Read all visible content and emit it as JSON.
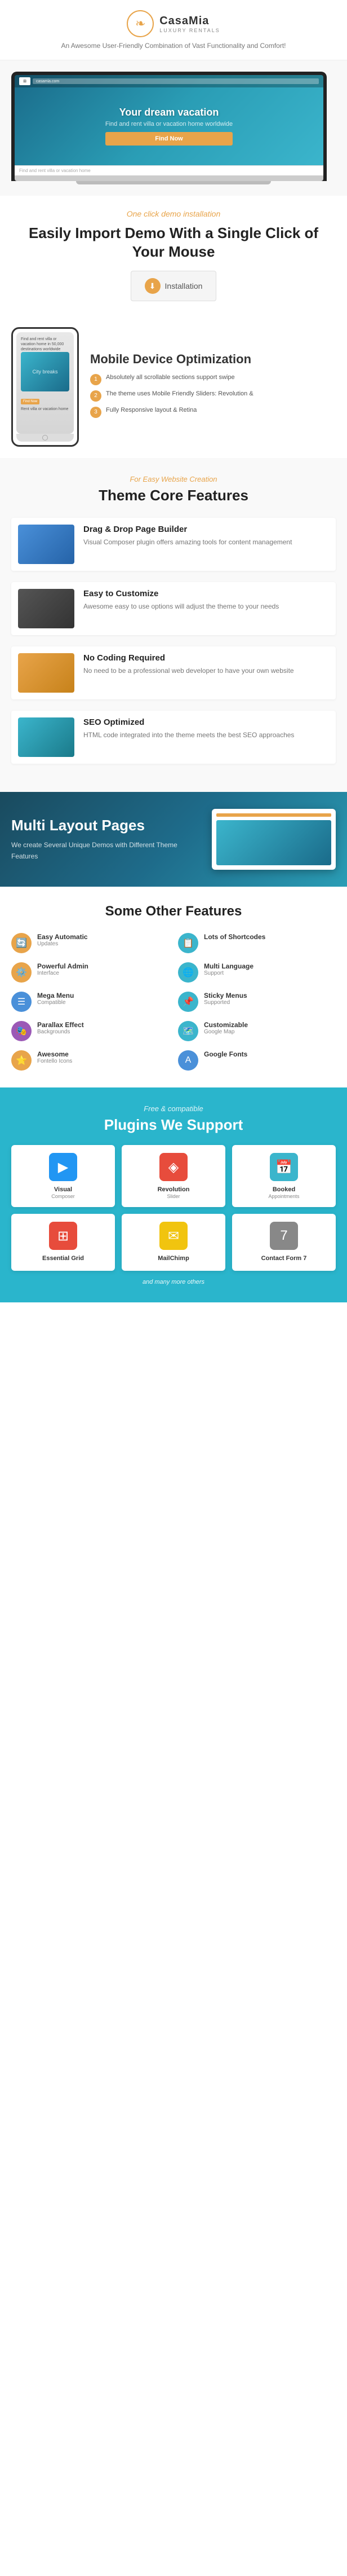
{
  "header": {
    "logo_name": "CasaMia",
    "logo_sub": "LUXURY RENTALS",
    "tagline": "An Awesome User-Friendly Combination of Vast Functionality and Comfort!"
  },
  "laptop": {
    "screen_text": "Your dream vacation",
    "screen_sub": "Find and rent villa or vacation home worldwide",
    "screen_btn": "Find Now",
    "search_bar": "Find and rent villa or vacation home"
  },
  "demo": {
    "italic_label": "One click demo installation",
    "title": "Easily Import Demo With a Single Click of Your Mouse",
    "install_button": "Installation"
  },
  "mobile": {
    "title": "Mobile Device Optimization",
    "items": [
      {
        "num": "1",
        "text": "Absolutely all scrollable sections support swipe"
      },
      {
        "num": "2",
        "text": "The theme uses Mobile Friendly Sliders: Revolution &"
      },
      {
        "num": "3",
        "text": "Fully Responsive layout & Retina"
      }
    ],
    "phone_img_text": "City breaks",
    "phone_search": "Find and rent villa or vacation home in 50,000 destinations worldwide"
  },
  "theme_features": {
    "italic_label": "For Easy Website Creation",
    "title": "Theme Core Features",
    "items": [
      {
        "name": "Drag & Drop Page Builder",
        "desc": "Visual Composer plugin offers amazing tools for content management",
        "thumb_class": "thumb-blue"
      },
      {
        "name": "Easy to Customize",
        "desc": "Awesome easy to use options will adjust the theme to your needs",
        "thumb_class": "thumb-dark"
      },
      {
        "name": "No Coding Required",
        "desc": "No need to be a professional web developer to have your own website",
        "thumb_class": "thumb-orange"
      },
      {
        "name": "SEO Optimized",
        "desc": "HTML code integrated into the theme meets the best SEO approaches",
        "thumb_class": "thumb-teal"
      }
    ]
  },
  "multi_layout": {
    "title": "Multi Layout Pages",
    "desc": "We create Several Unique Demos with Different Theme Features"
  },
  "other_features": {
    "title": "Some Other Features",
    "items": [
      {
        "icon": "🔄",
        "color": "feat-icon-orange",
        "name": "Easy Automatic",
        "sub": "Updates"
      },
      {
        "icon": "📋",
        "color": "feat-icon-teal",
        "name": "Lots of Shortcodes",
        "sub": ""
      },
      {
        "icon": "⚙️",
        "color": "feat-icon-orange",
        "name": "Powerful Admin",
        "sub": "Interface"
      },
      {
        "icon": "🌐",
        "color": "feat-icon-teal",
        "name": "Multi Language",
        "sub": "Support"
      },
      {
        "icon": "☰",
        "color": "feat-icon-blue",
        "name": "Mega Menu",
        "sub": "Compatible"
      },
      {
        "icon": "📌",
        "color": "feat-icon-teal",
        "name": "Sticky Menus",
        "sub": "Supported"
      },
      {
        "icon": "🎭",
        "color": "feat-icon-purple",
        "name": "Parallax Effect",
        "sub": "Backgrounds"
      },
      {
        "icon": "🗺️",
        "color": "feat-icon-teal",
        "name": "Customizable",
        "sub": "Google Map"
      },
      {
        "icon": "⭐",
        "color": "feat-icon-orange",
        "name": "Awesome",
        "sub": "Fontello Icons"
      },
      {
        "icon": "A",
        "color": "feat-icon-blue",
        "name": "Google Fonts",
        "sub": ""
      }
    ]
  },
  "plugins": {
    "italic_label": "Free & compatible",
    "title": "Plugins We Support",
    "items": [
      {
        "icon": "▶",
        "color": "plugin-icon-vc",
        "name": "Visual",
        "sub": "Composer"
      },
      {
        "icon": "◈",
        "color": "plugin-icon-rs",
        "name": "Revolution",
        "sub": "Slider"
      },
      {
        "icon": "📅",
        "color": "plugin-icon-booked",
        "name": "Booked",
        "sub": "Appointments"
      },
      {
        "icon": "⊞",
        "color": "plugin-icon-eg",
        "name": "Essential Grid",
        "sub": ""
      },
      {
        "icon": "✉",
        "color": "plugin-icon-mc",
        "name": "MailChimp",
        "sub": ""
      },
      {
        "icon": "7",
        "color": "plugin-icon-cf",
        "name": "Contact Form 7",
        "sub": ""
      }
    ],
    "footer": "and many more others"
  }
}
